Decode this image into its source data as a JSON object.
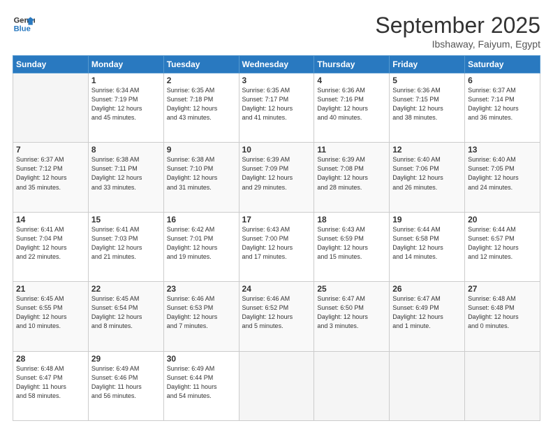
{
  "header": {
    "logo_line1": "General",
    "logo_line2": "Blue",
    "month": "September 2025",
    "location": "Ibshaway, Faiyum, Egypt"
  },
  "weekdays": [
    "Sunday",
    "Monday",
    "Tuesday",
    "Wednesday",
    "Thursday",
    "Friday",
    "Saturday"
  ],
  "weeks": [
    [
      {
        "day": "",
        "info": ""
      },
      {
        "day": "1",
        "info": "Sunrise: 6:34 AM\nSunset: 7:19 PM\nDaylight: 12 hours\nand 45 minutes."
      },
      {
        "day": "2",
        "info": "Sunrise: 6:35 AM\nSunset: 7:18 PM\nDaylight: 12 hours\nand 43 minutes."
      },
      {
        "day": "3",
        "info": "Sunrise: 6:35 AM\nSunset: 7:17 PM\nDaylight: 12 hours\nand 41 minutes."
      },
      {
        "day": "4",
        "info": "Sunrise: 6:36 AM\nSunset: 7:16 PM\nDaylight: 12 hours\nand 40 minutes."
      },
      {
        "day": "5",
        "info": "Sunrise: 6:36 AM\nSunset: 7:15 PM\nDaylight: 12 hours\nand 38 minutes."
      },
      {
        "day": "6",
        "info": "Sunrise: 6:37 AM\nSunset: 7:14 PM\nDaylight: 12 hours\nand 36 minutes."
      }
    ],
    [
      {
        "day": "7",
        "info": "Sunrise: 6:37 AM\nSunset: 7:12 PM\nDaylight: 12 hours\nand 35 minutes."
      },
      {
        "day": "8",
        "info": "Sunrise: 6:38 AM\nSunset: 7:11 PM\nDaylight: 12 hours\nand 33 minutes."
      },
      {
        "day": "9",
        "info": "Sunrise: 6:38 AM\nSunset: 7:10 PM\nDaylight: 12 hours\nand 31 minutes."
      },
      {
        "day": "10",
        "info": "Sunrise: 6:39 AM\nSunset: 7:09 PM\nDaylight: 12 hours\nand 29 minutes."
      },
      {
        "day": "11",
        "info": "Sunrise: 6:39 AM\nSunset: 7:08 PM\nDaylight: 12 hours\nand 28 minutes."
      },
      {
        "day": "12",
        "info": "Sunrise: 6:40 AM\nSunset: 7:06 PM\nDaylight: 12 hours\nand 26 minutes."
      },
      {
        "day": "13",
        "info": "Sunrise: 6:40 AM\nSunset: 7:05 PM\nDaylight: 12 hours\nand 24 minutes."
      }
    ],
    [
      {
        "day": "14",
        "info": "Sunrise: 6:41 AM\nSunset: 7:04 PM\nDaylight: 12 hours\nand 22 minutes."
      },
      {
        "day": "15",
        "info": "Sunrise: 6:41 AM\nSunset: 7:03 PM\nDaylight: 12 hours\nand 21 minutes."
      },
      {
        "day": "16",
        "info": "Sunrise: 6:42 AM\nSunset: 7:01 PM\nDaylight: 12 hours\nand 19 minutes."
      },
      {
        "day": "17",
        "info": "Sunrise: 6:43 AM\nSunset: 7:00 PM\nDaylight: 12 hours\nand 17 minutes."
      },
      {
        "day": "18",
        "info": "Sunrise: 6:43 AM\nSunset: 6:59 PM\nDaylight: 12 hours\nand 15 minutes."
      },
      {
        "day": "19",
        "info": "Sunrise: 6:44 AM\nSunset: 6:58 PM\nDaylight: 12 hours\nand 14 minutes."
      },
      {
        "day": "20",
        "info": "Sunrise: 6:44 AM\nSunset: 6:57 PM\nDaylight: 12 hours\nand 12 minutes."
      }
    ],
    [
      {
        "day": "21",
        "info": "Sunrise: 6:45 AM\nSunset: 6:55 PM\nDaylight: 12 hours\nand 10 minutes."
      },
      {
        "day": "22",
        "info": "Sunrise: 6:45 AM\nSunset: 6:54 PM\nDaylight: 12 hours\nand 8 minutes."
      },
      {
        "day": "23",
        "info": "Sunrise: 6:46 AM\nSunset: 6:53 PM\nDaylight: 12 hours\nand 7 minutes."
      },
      {
        "day": "24",
        "info": "Sunrise: 6:46 AM\nSunset: 6:52 PM\nDaylight: 12 hours\nand 5 minutes."
      },
      {
        "day": "25",
        "info": "Sunrise: 6:47 AM\nSunset: 6:50 PM\nDaylight: 12 hours\nand 3 minutes."
      },
      {
        "day": "26",
        "info": "Sunrise: 6:47 AM\nSunset: 6:49 PM\nDaylight: 12 hours\nand 1 minute."
      },
      {
        "day": "27",
        "info": "Sunrise: 6:48 AM\nSunset: 6:48 PM\nDaylight: 12 hours\nand 0 minutes."
      }
    ],
    [
      {
        "day": "28",
        "info": "Sunrise: 6:48 AM\nSunset: 6:47 PM\nDaylight: 11 hours\nand 58 minutes."
      },
      {
        "day": "29",
        "info": "Sunrise: 6:49 AM\nSunset: 6:46 PM\nDaylight: 11 hours\nand 56 minutes."
      },
      {
        "day": "30",
        "info": "Sunrise: 6:49 AM\nSunset: 6:44 PM\nDaylight: 11 hours\nand 54 minutes."
      },
      {
        "day": "",
        "info": ""
      },
      {
        "day": "",
        "info": ""
      },
      {
        "day": "",
        "info": ""
      },
      {
        "day": "",
        "info": ""
      }
    ]
  ]
}
